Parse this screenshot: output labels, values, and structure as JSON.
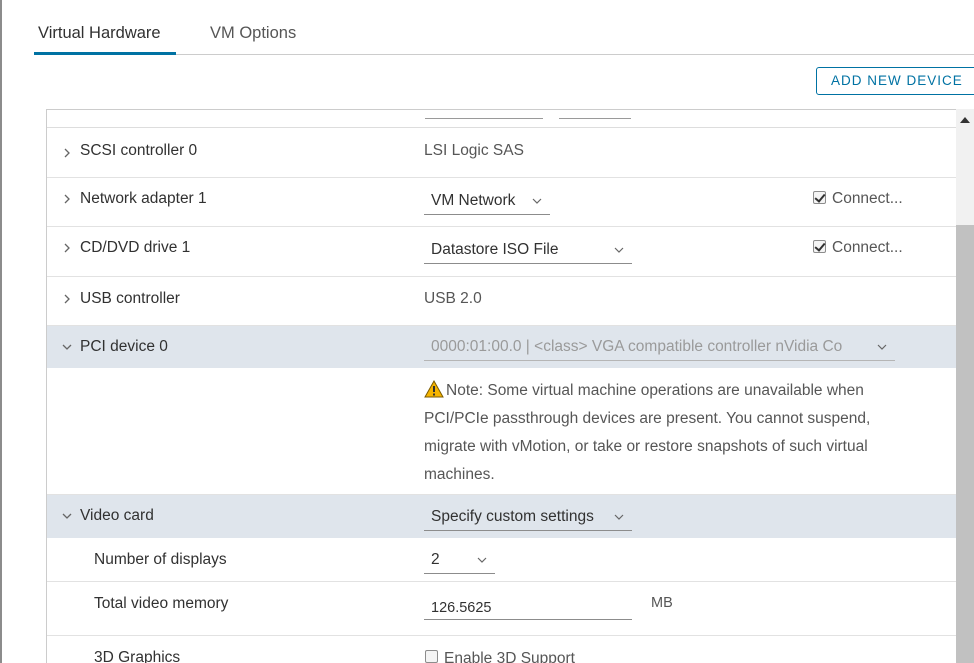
{
  "tabs": [
    {
      "label": "Virtual Hardware",
      "active": true
    },
    {
      "label": "VM Options",
      "active": false
    }
  ],
  "add_device_label": "ADD NEW DEVICE",
  "rows": {
    "scsi": {
      "label": "SCSI controller 0",
      "value": "LSI Logic SAS"
    },
    "network": {
      "label": "Network adapter 1",
      "value": "VM Network",
      "connect_label": "Connect...",
      "connected": true
    },
    "cdrom": {
      "label": "CD/DVD drive 1",
      "value": "Datastore ISO File",
      "connect_label": "Connect...",
      "connected": true
    },
    "usb": {
      "label": "USB controller",
      "value": "USB 2.0"
    },
    "pci": {
      "label": "PCI device 0",
      "value": "0000:01:00.0 | <class> VGA compatible controller nVidia Co",
      "note": "Note: Some virtual machine operations are unavailable when PCI/PCIe passthrough devices are present. You cannot suspend, migrate with vMotion, or take or restore snapshots of such virtual machines."
    },
    "video": {
      "label": "Video card",
      "value": "Specify custom settings",
      "displays_label": "Number of displays",
      "displays_value": "2",
      "memory_label": "Total video memory",
      "memory_value": "126.5625",
      "memory_unit": "MB",
      "graphics_label": "3D Graphics",
      "enable3d_label": "Enable 3D Support",
      "enable3d": false
    }
  },
  "colors": {
    "accent": "#0072a3",
    "highlight_row": "#dfe5ec",
    "warning": "#e8a200"
  }
}
